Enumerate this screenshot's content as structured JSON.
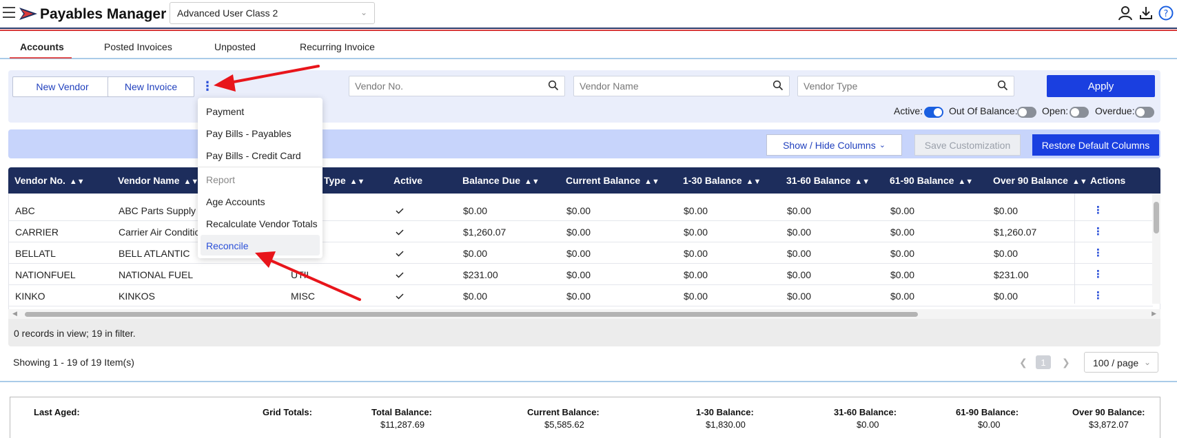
{
  "header": {
    "app_title": "Payables Manager",
    "class_select_value": "Advanced User Class 2",
    "icons": [
      "menu-icon",
      "logo-icon",
      "user-icon",
      "download-icon",
      "help-icon"
    ]
  },
  "tabs": [
    {
      "label": "Accounts",
      "active": true
    },
    {
      "label": "Posted Invoices",
      "active": false
    },
    {
      "label": "Unposted",
      "active": false
    },
    {
      "label": "Recurring Invoice",
      "active": false
    }
  ],
  "filters": {
    "new_vendor_label": "New Vendor",
    "new_invoice_label": "New Invoice",
    "vendor_no_placeholder": "Vendor No.",
    "vendor_name_placeholder": "Vendor Name",
    "vendor_type_placeholder": "Vendor Type",
    "apply_label": "Apply",
    "toggles": [
      {
        "label": "Active:",
        "on": true
      },
      {
        "label": "Out Of Balance:",
        "on": false
      },
      {
        "label": "Open:",
        "on": false
      },
      {
        "label": "Overdue:",
        "on": false
      }
    ]
  },
  "column_toolbar": {
    "show_hide_label": "Show / Hide Columns",
    "save_label": "Save Customization",
    "restore_label": "Restore Default Columns"
  },
  "grid": {
    "columns": [
      "Vendor No.",
      "Vendor Name",
      "Type",
      "Active",
      "Balance Due",
      "Current Balance",
      "1-30 Balance",
      "31-60 Balance",
      "61-90 Balance",
      "Over 90 Balance",
      "Actions"
    ],
    "rows": [
      {
        "vendor_no": "ABC",
        "vendor_name": "ABC Parts Supply",
        "type": "",
        "balance_due": "$0.00",
        "current": "$0.00",
        "b1_30": "$0.00",
        "b31_60": "$0.00",
        "b61_90": "$0.00",
        "over90": "$0.00"
      },
      {
        "vendor_no": "CARRIER",
        "vendor_name": "Carrier Air Conditio",
        "type": "",
        "balance_due": "$1,260.07",
        "current": "$0.00",
        "b1_30": "$0.00",
        "b31_60": "$0.00",
        "b61_90": "$0.00",
        "over90": "$1,260.07"
      },
      {
        "vendor_no": "BELLATL",
        "vendor_name": "BELL ATLANTIC",
        "type": "",
        "balance_due": "$0.00",
        "current": "$0.00",
        "b1_30": "$0.00",
        "b31_60": "$0.00",
        "b61_90": "$0.00",
        "over90": "$0.00"
      },
      {
        "vendor_no": "NATIONFUEL",
        "vendor_name": "NATIONAL FUEL",
        "type": "UTIL",
        "balance_due": "$231.00",
        "current": "$0.00",
        "b1_30": "$0.00",
        "b31_60": "$0.00",
        "b61_90": "$0.00",
        "over90": "$231.00"
      },
      {
        "vendor_no": "KINKO",
        "vendor_name": "KINKOS",
        "type": "MISC",
        "balance_due": "$0.00",
        "current": "$0.00",
        "b1_30": "$0.00",
        "b31_60": "$0.00",
        "b61_90": "$0.00",
        "over90": "$0.00"
      }
    ],
    "footer_text": "0 records in view; 19 in filter."
  },
  "pagination": {
    "showing_text": "Showing 1 - 19 of 19 Item(s)",
    "current_page": "1",
    "per_page": "100 / page"
  },
  "totals": {
    "last_aged_label": "Last Aged:",
    "grid_totals_label": "Grid Totals:",
    "items": [
      {
        "label": "Total Balance:",
        "value": "$11,287.69"
      },
      {
        "label": "Current Balance:",
        "value": "$5,585.62"
      },
      {
        "label": "1-30 Balance:",
        "value": "$1,830.00"
      },
      {
        "label": "31-60 Balance:",
        "value": "$0.00"
      },
      {
        "label": "61-90 Balance:",
        "value": "$0.00"
      },
      {
        "label": "Over 90 Balance:",
        "value": "$3,872.07"
      }
    ]
  },
  "menu": {
    "items": [
      "Payment",
      "Pay Bills - Payables",
      "Pay Bills - Credit Card",
      "Report",
      "Age Accounts",
      "Recalculate Vendor Totals",
      "Reconcile"
    ]
  },
  "colors": {
    "accent_blue": "#1a3fe0",
    "header_navy": "#1d2d5c",
    "annotation_red": "#e8151b"
  }
}
